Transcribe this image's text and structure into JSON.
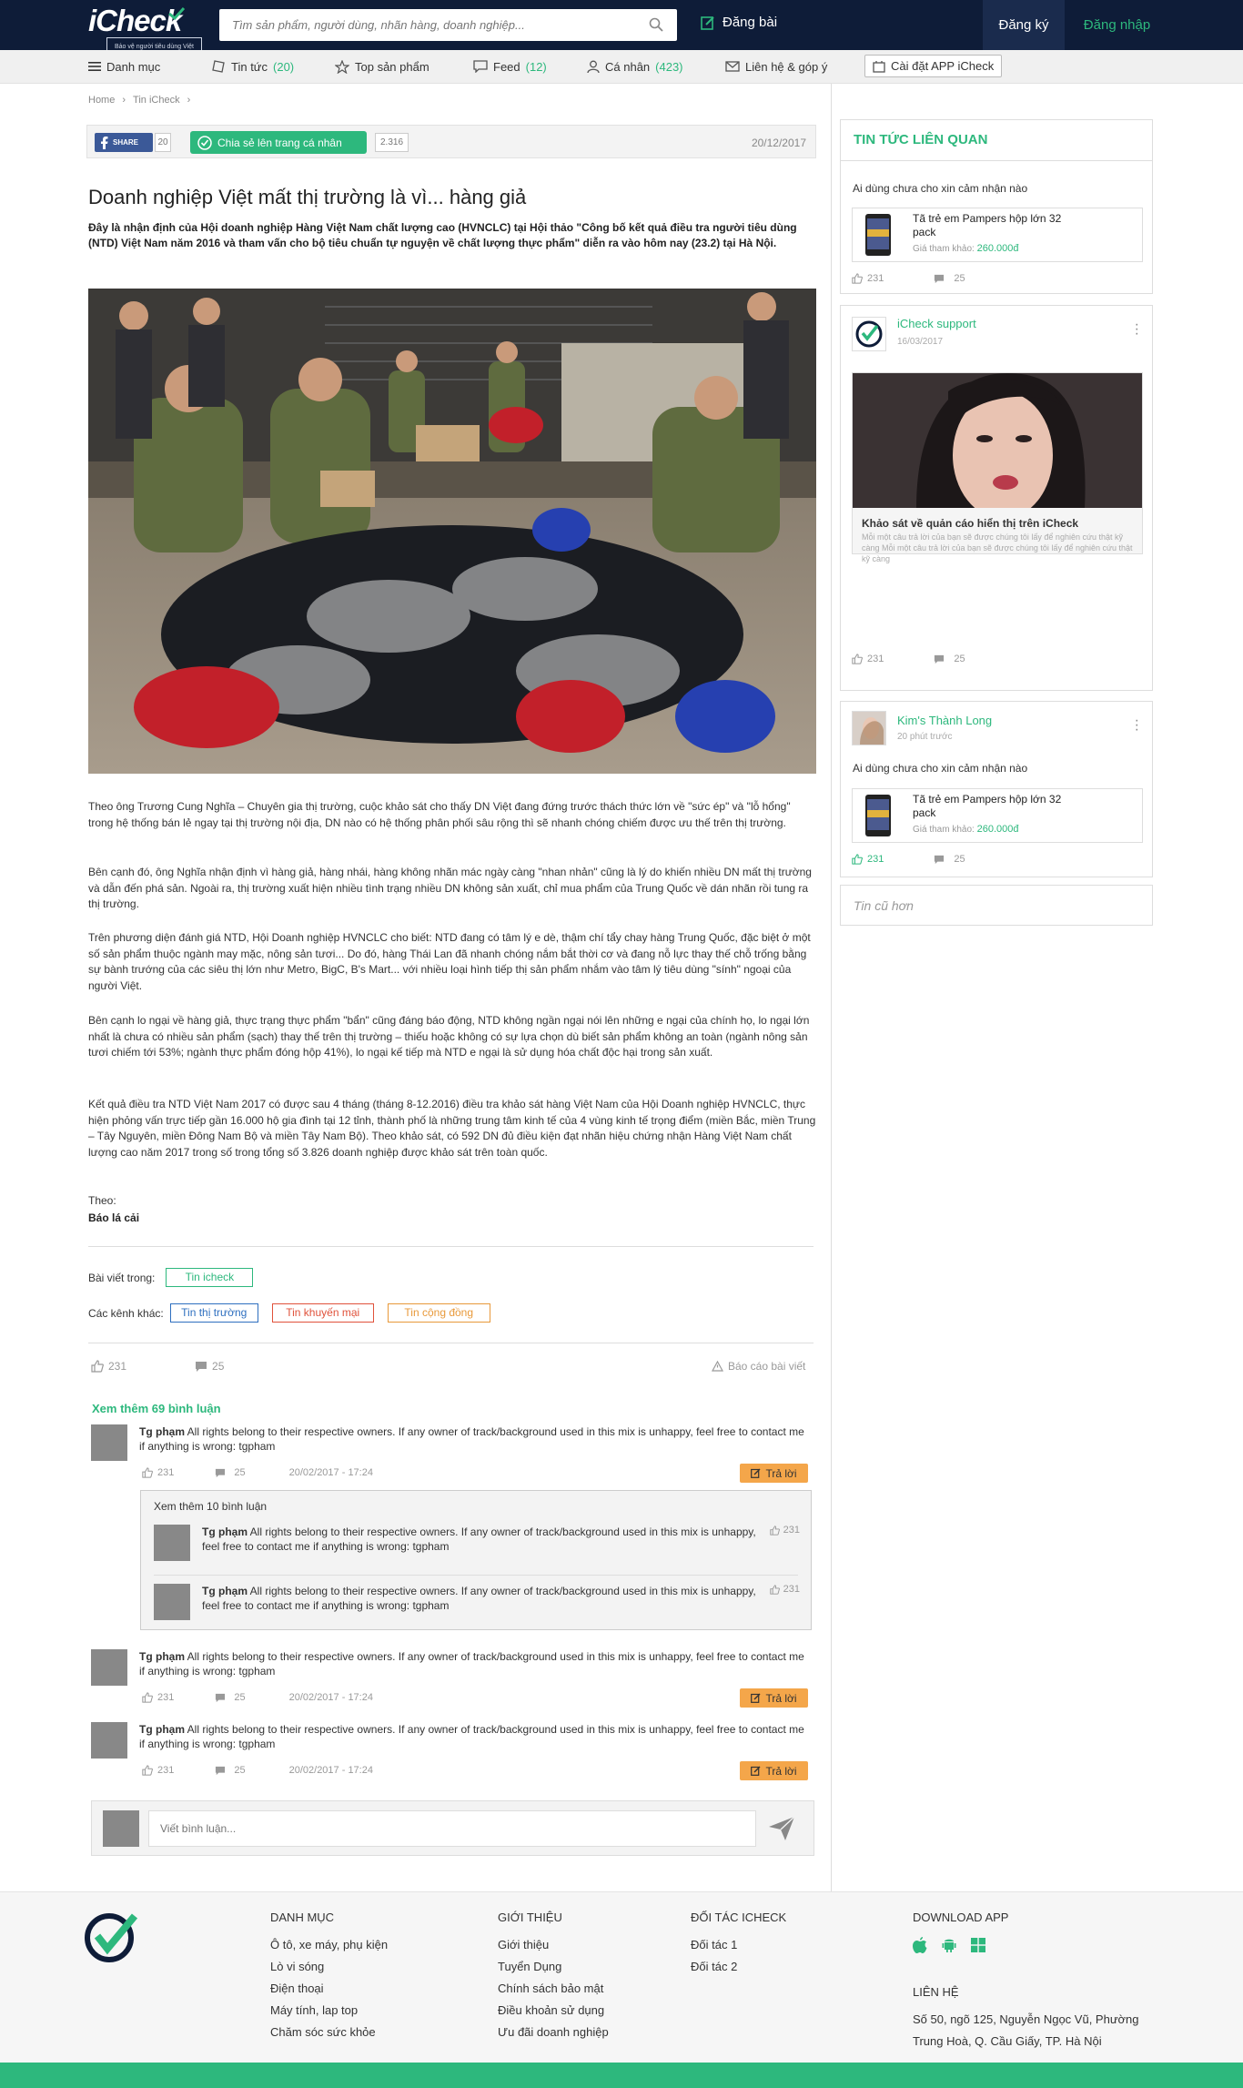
{
  "header": {
    "logo_text": "iCheck",
    "logo_tagline": "Bảo vệ người tiêu dùng Việt",
    "search_placeholder": "Tìm sản phẩm, người dùng, nhãn hàng, doanh nghiệp...",
    "post_label": "Đăng bài",
    "register_label": "Đăng ký",
    "login_label": "Đăng nhập"
  },
  "nav": {
    "menu": "Danh mục",
    "news": "Tin tức",
    "news_count": "(20)",
    "top": "Top sản phẩm",
    "feed": "Feed",
    "feed_count": "(12)",
    "personal": "Cá nhân",
    "personal_count": "(423)",
    "contact": "Liên hệ & góp ý",
    "app": "Cài đặt APP iCheck"
  },
  "breadcrumb": [
    "Home",
    "Tin iCheck"
  ],
  "share": {
    "fb_label": "SHARE",
    "fb_count": "20",
    "share_label": "Chia sẻ lên trang cá nhân",
    "share_count": "2.316",
    "date": "20/12/2017"
  },
  "article": {
    "title": "Doanh nghiệp Việt mất thị trường là vì... hàng giả",
    "lead": "Đây là nhận định của Hội doanh nghiệp Hàng Việt Nam chất lượng cao (HVNCLC) tại Hội thảo \"Công bố kết quả điều tra người tiêu dùng (NTD) Việt Nam năm 2016 và tham vấn cho bộ tiêu chuẩn tự nguyện về chất lượng thực phẩm\" diễn ra vào hôm nay (23.2) tại Hà Nội.",
    "paragraphs": [
      "Theo ông Trương Cung Nghĩa – Chuyên gia thị trường, cuộc khảo sát cho thấy DN Việt đang đứng trước thách thức lớn về \"sức ép\" và \"lỗ hổng\" trong hệ thống bán lẻ ngay tại thị trường nội địa, DN nào có hệ thống phân phối sâu rộng thì sẽ nhanh chóng chiếm được ưu thế trên thị trường.",
      "Bên cạnh đó, ông Nghĩa nhận định vì hàng giả, hàng nhái, hàng không nhãn mác ngày càng \"nhan nhản\" cũng là lý do khiến nhiều DN mất thị trường và dẫn đến phá sản. Ngoài ra, thị trường xuất hiện nhiều tình trạng nhiều DN không sản xuất, chỉ mua phẩm của Trung Quốc về dán nhãn rồi tung ra thị trường.",
      "Trên phương diện đánh giá NTD, Hội Doanh nghiệp HVNCLC cho biết: NTD đang có tâm lý e dè, thậm chí tẩy chay hàng Trung Quốc, đặc biệt ở một số sản phẩm thuộc ngành may mặc, nông sản tươi... Do đó, hàng Thái Lan đã nhanh chóng nắm bắt thời cơ và đang nỗ lực thay thế chỗ trống bằng sự bành trướng của các siêu thị lớn như Metro, BigC, B's Mart... với nhiều loại hình tiếp thị sản phẩm nhắm vào tâm lý tiêu dùng \"sính\" ngoại của người Việt.",
      "Bên cạnh lo ngại về hàng giả, thực trạng thực phẩm \"bẩn\" cũng đáng báo động, NTD không ngần ngại nói lên những e ngại của chính họ, lo ngại lớn nhất là chưa có nhiều sản phẩm (sạch) thay thế trên thị trường – thiếu hoặc không có sự lựa chọn dù biết sản phẩm không an toàn (ngành nông sản tươi chiếm tới 53%; ngành thực phẩm đóng hộp 41%), lo ngại kế tiếp mà NTD e ngại là sử dụng hóa chất độc hại trong sản xuất.",
      "Kết quả điều tra NTD Việt Nam 2017 có được sau 4 tháng (tháng 8-12.2016) điều tra khảo sát hàng Việt Nam của Hội Doanh nghiệp HVNCLC, thực hiện phỏng vấn trực tiếp gần 16.000 hộ gia đình tại 12 tỉnh, thành phố là những trung tâm kinh tế của 4 vùng kinh tế trọng điểm (miền Bắc, miền Trung – Tây Nguyên, miền Đông Nam Bộ và miền Tây Nam Bộ). Theo khảo sát, có 592 DN đủ điều kiện đạt nhãn hiệu chứng nhận Hàng Việt Nam chất lượng cao năm 2017 trong số trong tổng số 3.826 doanh nghiệp được khảo sát trên toàn quốc."
    ],
    "source_label": "Theo:",
    "source_name": "Báo lá cải",
    "in_label": "Bài viết trong:",
    "in_tag": "Tin icheck",
    "other_label": "Các kênh khác:",
    "other_tags": [
      "Tin thị trường",
      "Tin khuyến mại",
      "Tin cộng đồng"
    ],
    "likes": "231",
    "comments": "25",
    "report": "Báo cáo bài viết"
  },
  "comments": {
    "more_label": "Xem thêm 69 bình luận",
    "author": "Tg phạm",
    "text": "All rights belong to their respective owners. If any owner of track/background used in this mix is unhappy, feel free to contact me if anything is wrong: tgpham",
    "likes": "231",
    "replies": "25",
    "date": "20/02/2017 - 17:24",
    "reply_label": "Trả lời",
    "sub_more_label": "Xem thêm 10 bình luận",
    "sub_likes": "231",
    "input_placeholder": "Viết bình luận..."
  },
  "sidebar": {
    "related_header": "TIN TỨC LIÊN QUAN",
    "question": "Ai dùng chưa cho xin cảm nhận nào",
    "product_name": "Tã trẻ em Pampers hộp lớn 32 pack",
    "price_label": "Giá tham khảo:",
    "price": "260.000đ",
    "likes": "231",
    "comments": "25",
    "support_name": "iCheck support",
    "support_date": "16/03/2017",
    "survey_title": "Khảo sát về quản cáo hiển thị trên iCheck",
    "survey_desc": "Mỗi một câu trả lời của bạn sẽ được chúng tôi lấy để nghiên cứu thật kỹ càng Mỗi một câu trả lời của bạn sẽ được chúng tôi lấy để nghiên cứu thật kỹ càng",
    "user2_name": "Kim's Thành Long",
    "user2_time": "20 phút trước",
    "old_news": "Tin cũ hơn"
  },
  "footer": {
    "cat_header": "DANH MỤC",
    "cats": [
      "Ô tô, xe máy, phụ kiện",
      "Lò vi sóng",
      "Điện thoại",
      "Máy tính, lap top",
      "Chăm sóc sức khỏe"
    ],
    "intro_header": "GIỚI THIỆU",
    "intro": [
      "Giới thiệu",
      "Tuyển Dụng",
      "Chính sách bảo mật",
      "Điều khoản sử dụng",
      "Ưu đãi doanh nghiệp"
    ],
    "partner_header": "ĐỐI TÁC ICHECK",
    "partners": [
      "Đối tác 1",
      "Đối tác 2"
    ],
    "download_header": "DOWNLOAD APP",
    "contact_header": "LIÊN HỆ",
    "address": "Số 50, ngõ 125, Nguyễn Ngọc Vũ, Phường Trung Hoà, Q. Cầu Giấy, TP. Hà Nội"
  },
  "colors": {
    "brand_navy": "#0e1c38",
    "brand_green": "#2db87d",
    "reply_orange": "#f4a64a",
    "fb_blue": "#3b5998"
  }
}
